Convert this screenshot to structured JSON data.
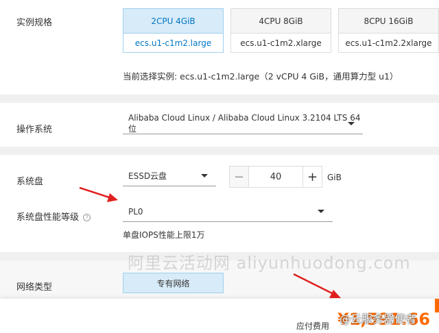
{
  "instance_spec": {
    "label": "实例规格",
    "cards": [
      {
        "cpu_mem": "2CPU 4GiB",
        "type": "ecs.u1-c1m2.large",
        "selected": true
      },
      {
        "cpu_mem": "4CPU 8GiB",
        "type": "ecs.u1-c1m2.xlarge",
        "selected": false
      },
      {
        "cpu_mem": "8CPU 16GiB",
        "type": "ecs.u1-c1m2.2xlarge",
        "selected": false
      }
    ],
    "current": "当前选择实例: ecs.u1-c1m2.large（2 vCPU 4 GiB，通用算力型 u1）"
  },
  "os": {
    "label": "操作系统",
    "value": "Alibaba Cloud Linux / Alibaba Cloud Linux 3.2104 LTS 64位"
  },
  "system_disk": {
    "label": "系统盘",
    "type": "ESSD云盘",
    "size": "40",
    "unit": "GiB",
    "minus": "−",
    "plus": "+"
  },
  "disk_performance": {
    "label": "系统盘性能等级",
    "help": "?",
    "value": "PL0",
    "hint": "单盘IOPS性能上限1万"
  },
  "network": {
    "label": "网络类型",
    "option": "专有网络"
  },
  "watermark": "阿里云活动网 aliyunhuodong.com",
  "footer": {
    "fee_label": "应付费用",
    "fee_value": "¥1,591.66",
    "author": "@云服务器使者"
  },
  "colors": {
    "accent": "#0076c6",
    "selected_bg": "#d7ebf8",
    "price": "#ff6a00",
    "arrow": "#e0201e"
  }
}
